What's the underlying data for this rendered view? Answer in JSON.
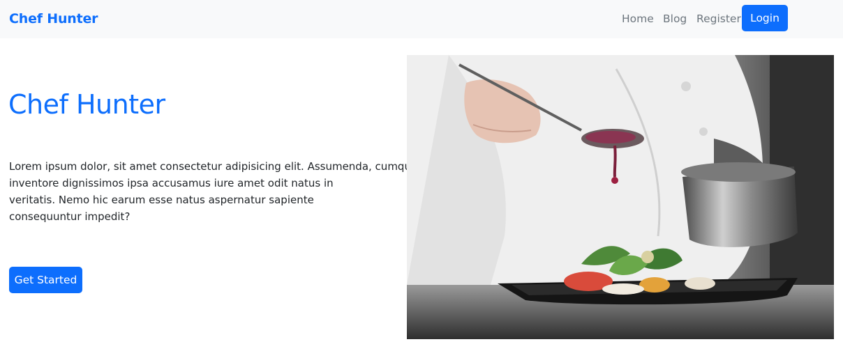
{
  "navbar": {
    "brand": "Chef Hunter",
    "links": [
      {
        "label": "Home"
      },
      {
        "label": "Blog"
      },
      {
        "label": "Register"
      }
    ],
    "login_label": "Login"
  },
  "hero": {
    "title": "Chef Hunter",
    "description_lines": [
      "Lorem ipsum dolor, sit amet consectetur adipisicing elit. Assumenda, cumque",
      "inventore dignissimos ipsa accusamus iure amet odit natus in",
      "veritatis. Nemo hic earum esse natus aspernatur sapiente",
      "consequuntur impedit?"
    ],
    "cta_label": "Get Started"
  },
  "colors": {
    "primary": "#0d6efd",
    "navbar_bg": "#f8f9fa",
    "nav_link": "#6c757d",
    "text": "#212529"
  }
}
